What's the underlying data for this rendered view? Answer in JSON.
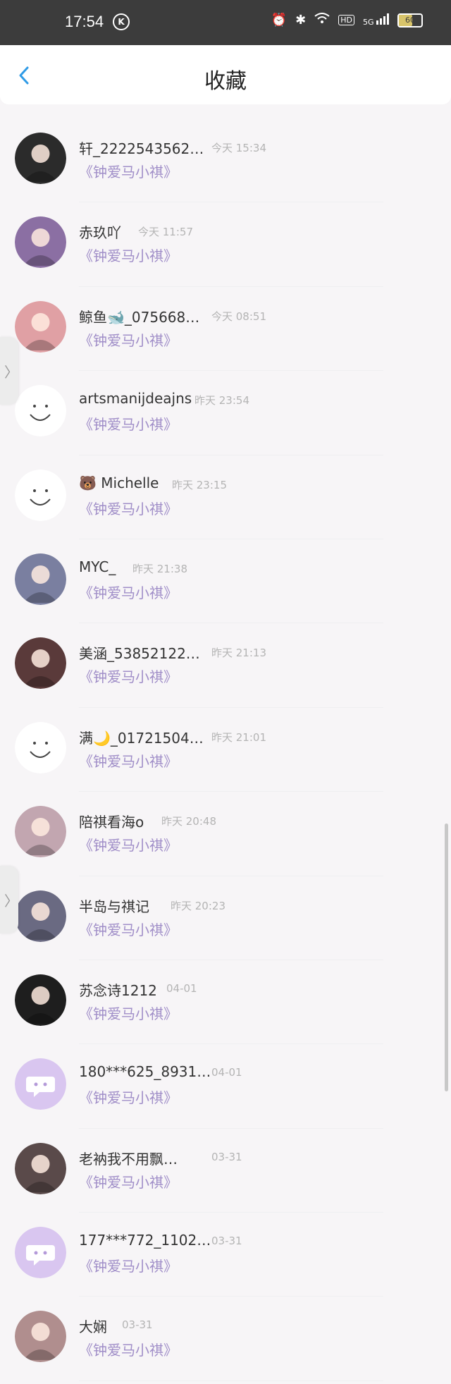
{
  "status": {
    "time": "17:54",
    "k_label": "K",
    "battery": "60",
    "net_label": "5G"
  },
  "header": {
    "title": "收藏"
  },
  "items": [
    {
      "name": "轩_2222543562…",
      "time": "今天 15:34",
      "book": "《钟爱马小祺》",
      "avatar_color": "#2b2b2b"
    },
    {
      "name": "赤玖吖",
      "time": "今天 11:57",
      "book": "《钟爱马小祺》",
      "avatar_color": "#8b6fa3"
    },
    {
      "name": "鲸鱼🐋_075668…",
      "time": "今天 08:51",
      "book": "《钟爱马小祺》",
      "avatar_color": "#e0a0a4"
    },
    {
      "name": "artsmanijdeajns",
      "time": "昨天 23:54",
      "book": "《钟爱马小祺》",
      "avatar_color": "#ffffff"
    },
    {
      "name": "🐻 Michelle",
      "time": "昨天 23:15",
      "book": "《钟爱马小祺》",
      "avatar_color": "#ffffff"
    },
    {
      "name": "MYC_",
      "time": "昨天 21:38",
      "book": "《钟爱马小祺》",
      "avatar_color": "#7a7fa0"
    },
    {
      "name": "美涵_53852122…",
      "time": "昨天 21:13",
      "book": "《钟爱马小祺》",
      "avatar_color": "#5a3a3a"
    },
    {
      "name": "满🌙_01721504…",
      "time": "昨天 21:01",
      "book": "《钟爱马小祺》",
      "avatar_color": "#ffffff"
    },
    {
      "name": "陪祺看海o",
      "time": "昨天 20:48",
      "book": "《钟爱马小祺》",
      "avatar_color": "#c2a6b0"
    },
    {
      "name": "半岛与祺记",
      "time": "昨天 20:23",
      "book": "《钟爱马小祺》",
      "avatar_color": "#6a6a82"
    },
    {
      "name": "苏念诗1212",
      "time": "04-01",
      "book": "《钟爱马小祺》",
      "avatar_color": "#1e1e1e"
    },
    {
      "name": "180***625_8931…",
      "time": "04-01",
      "book": "《钟爱马小祺》",
      "avatar_color": "#d9c6f0"
    },
    {
      "name": "老衲我不用飘…",
      "time": "03-31",
      "book": "《钟爱马小祺》",
      "avatar_color": "#5a4a4a"
    },
    {
      "name": "177***772_1102…",
      "time": "03-31",
      "book": "《钟爱马小祺》",
      "avatar_color": "#d9c6f0"
    },
    {
      "name": "大娴",
      "time": "03-31",
      "book": "《钟爱马小祺》",
      "avatar_color": "#b08e8e"
    }
  ],
  "colors": {
    "accent": "#2f9be6",
    "book_text": "#a08ec8",
    "time_text": "#b4b4b4"
  }
}
